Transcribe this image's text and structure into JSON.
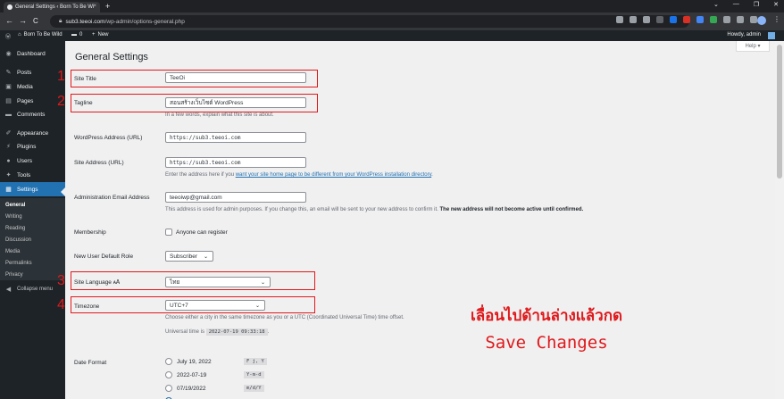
{
  "browser": {
    "tab_title": "General Settings ‹ Born To Be Wi",
    "tab_close": "×",
    "new_tab": "+",
    "window_controls": [
      "⌄",
      "—",
      "❐",
      "✕"
    ],
    "url_host": "sub3.teeoi.com",
    "url_path": "/wp-admin/options-general.php",
    "back": "←",
    "forward": "→",
    "reload": "C",
    "menu": "⋮"
  },
  "adminbar": {
    "site_name": "Born To Be Wild",
    "comments_count": "0",
    "new_label": "New",
    "howdy": "Howdy, admin"
  },
  "sidebar": {
    "items": [
      {
        "label": "Dashboard",
        "icon": "dashboard-icon",
        "glyph": "◉"
      },
      {
        "label": "Posts",
        "icon": "pin-icon",
        "glyph": "✎"
      },
      {
        "label": "Media",
        "icon": "media-icon",
        "glyph": "▣"
      },
      {
        "label": "Pages",
        "icon": "pages-icon",
        "glyph": "▤"
      },
      {
        "label": "Comments",
        "icon": "comments-icon",
        "glyph": "▬"
      },
      {
        "label": "Appearance",
        "icon": "appearance-icon",
        "glyph": "✐"
      },
      {
        "label": "Plugins",
        "icon": "plugins-icon",
        "glyph": "⚡"
      },
      {
        "label": "Users",
        "icon": "users-icon",
        "glyph": "●"
      },
      {
        "label": "Tools",
        "icon": "tools-icon",
        "glyph": "✦"
      },
      {
        "label": "Settings",
        "icon": "settings-icon",
        "glyph": "▦"
      }
    ],
    "submenu": [
      "General",
      "Writing",
      "Reading",
      "Discussion",
      "Media",
      "Permalinks",
      "Privacy"
    ],
    "collapse": "Collapse menu"
  },
  "page": {
    "help": "Help ▾",
    "title": "General Settings",
    "site_title_label": "Site Title",
    "site_title_value": "TeeOi",
    "tagline_label": "Tagline",
    "tagline_value": "สอนสร้างเว็บไซต์ WordPress",
    "tagline_desc": "In a few words, explain what this site is about.",
    "wp_address_label": "WordPress Address (URL)",
    "wp_address_value": "https://sub3.teeoi.com",
    "site_address_label": "Site Address (URL)",
    "site_address_value": "https://sub3.teeoi.com",
    "site_address_desc_pre": "Enter the address here if you ",
    "site_address_desc_link": "want your site home page to be different from your WordPress installation directory",
    "site_address_desc_post": ".",
    "admin_email_label": "Administration Email Address",
    "admin_email_value": "teeoiwp@gmail.com",
    "admin_email_desc": "This address is used for admin purposes. If you change this, an email will be sent to your new address to confirm it. ",
    "admin_email_desc_bold": "The new address will not become active until confirmed.",
    "membership_label": "Membership",
    "membership_checkbox": "Anyone can register",
    "default_role_label": "New User Default Role",
    "default_role_value": "Subscriber",
    "language_label": "Site Language",
    "language_value": "ไทย",
    "timezone_label": "Timezone",
    "timezone_value": "UTC+7",
    "timezone_desc": "Choose either a city in the same timezone as you or a UTC (Coordinated Universal Time) time offset.",
    "universal_time_label": "Universal time is",
    "universal_time_value": "2022-07-19 09:33:18",
    "universal_time_end": ".",
    "date_format_label": "Date Format",
    "date_formats": [
      {
        "label": "July 19, 2022",
        "code": "F j, Y"
      },
      {
        "label": "2022-07-19",
        "code": "Y-m-d"
      },
      {
        "label": "07/19/2022",
        "code": "m/d/Y"
      }
    ]
  },
  "annotations": {
    "numbers": [
      "1",
      "2",
      "3",
      "4"
    ],
    "instruction_line1": "เลื่อนไปด้านล่างแล้วกด",
    "instruction_line2": "Save Changes",
    "color": "#e0191b"
  },
  "colors": {
    "wp_dark": "#1d2327",
    "wp_blue": "#2271b1",
    "link": "#2271b1"
  }
}
